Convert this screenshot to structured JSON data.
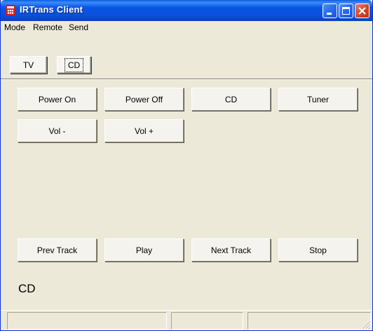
{
  "window": {
    "title": "IRTrans Client",
    "icon": "irtrans-app-icon",
    "controls": [
      "minimize-icon",
      "maximize-icon",
      "close-icon"
    ]
  },
  "menu": {
    "mode": "Mode",
    "remote": "Remote",
    "send": "Send"
  },
  "modes": {
    "tv": "TV",
    "cd": "CD",
    "selected": "CD"
  },
  "commands": {
    "power_on": "Power On",
    "power_off": "Power Off",
    "cd": "CD",
    "tuner": "Tuner",
    "vol_down": "Vol -",
    "vol_up": "Vol +",
    "prev_track": "Prev Track",
    "play": "Play",
    "next_track": "Next Track",
    "stop": "Stop"
  },
  "display": {
    "current_remote": "CD"
  },
  "colors": {
    "titlebar": "#0a4fd8",
    "window_bg": "#ece9d8",
    "close_button": "#d24b2d"
  }
}
